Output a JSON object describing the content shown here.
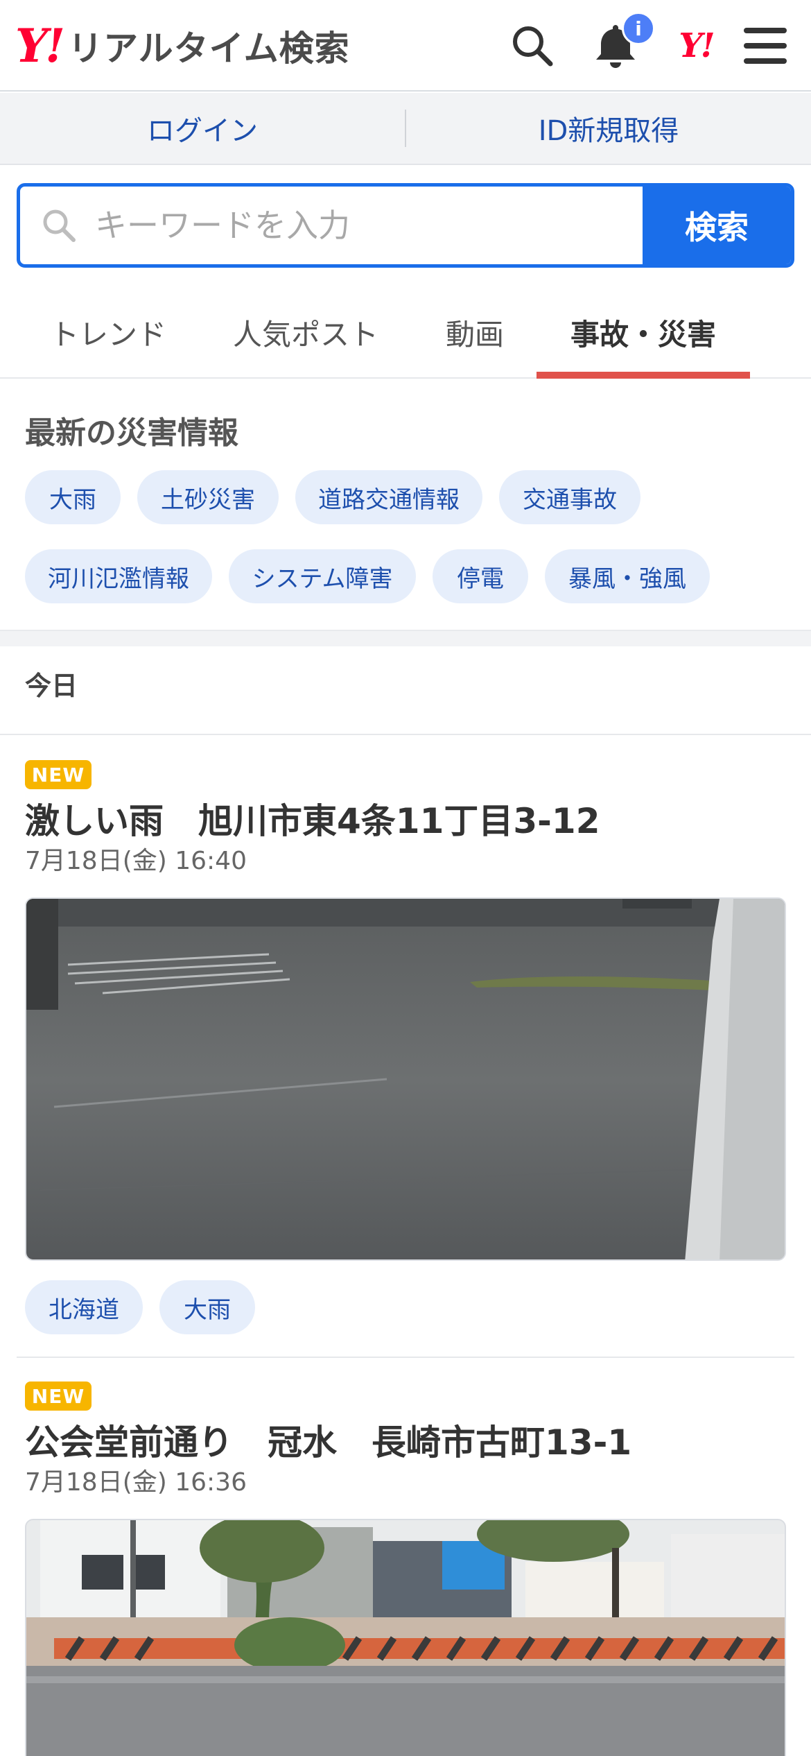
{
  "header": {
    "logo_mark": "Y!",
    "logo_title": "リアルタイム検索",
    "notification_count": "i",
    "yj_mark": "Y!"
  },
  "account": {
    "login_label": "ログイン",
    "register_label": "ID新規取得"
  },
  "search": {
    "placeholder": "キーワードを入力",
    "button_label": "検索"
  },
  "tabs": [
    {
      "label": "トレンド",
      "active": false
    },
    {
      "label": "人気ポスト",
      "active": false
    },
    {
      "label": "動画",
      "active": false
    },
    {
      "label": "事故・災害",
      "active": true
    }
  ],
  "disaster": {
    "title": "最新の災害情報",
    "chips": [
      "大雨",
      "土砂災害",
      "道路交通情報",
      "交通事故",
      "河川氾濫情報",
      "システム障害",
      "停電",
      "暴風・強風"
    ]
  },
  "feed": {
    "section_label": "今日",
    "posts": [
      {
        "badge": "NEW",
        "title": "激しい雨　旭川市東4条11丁目3-12",
        "time": "7月18日(金) 16:40",
        "tags": [
          "北海道",
          "大雨"
        ]
      },
      {
        "badge": "NEW",
        "title": "公会堂前通り　冠水　長崎市古町13-1",
        "time": "7月18日(金) 16:36",
        "tags": []
      }
    ]
  },
  "colors": {
    "brand_red": "#ff0033",
    "search_blue": "#1a6eea",
    "link_blue": "#1d4fad",
    "chip_bg": "#e6eefb",
    "tab_underline": "#e0524b",
    "new_badge": "#f7b500"
  }
}
